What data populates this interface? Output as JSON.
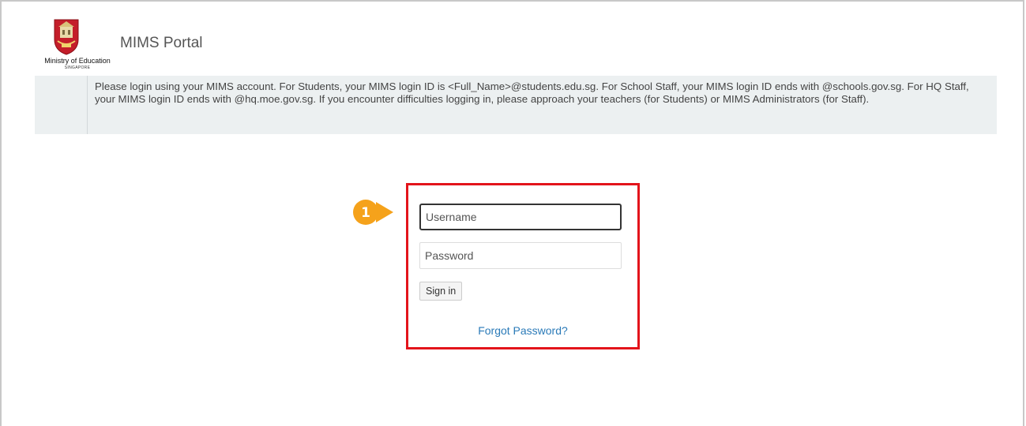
{
  "header": {
    "logo_line1": "Ministry of Education",
    "logo_line2": "SINGAPORE",
    "title": "MIMS Portal"
  },
  "notice": {
    "text": "Please login using your MIMS account. For Students, your MIMS login ID is <Full_Name>@students.edu.sg. For School Staff, your MIMS login ID ends with @schools.gov.sg. For HQ Staff, your MIMS login ID ends with @hq.moe.gov.sg. If you encounter difficulties logging in, please approach your teachers (for Students) or MIMS Administrators (for Staff)."
  },
  "login": {
    "username_placeholder": "Username",
    "password_placeholder": "Password",
    "signin_label": "Sign in",
    "forgot_label": "Forgot Password?"
  },
  "step_marker": {
    "number": "1",
    "color": "#f5a21b"
  },
  "colors": {
    "highlight_border": "#e3141b",
    "link": "#2a7ab8",
    "notice_bg": "#ecf0f1"
  }
}
